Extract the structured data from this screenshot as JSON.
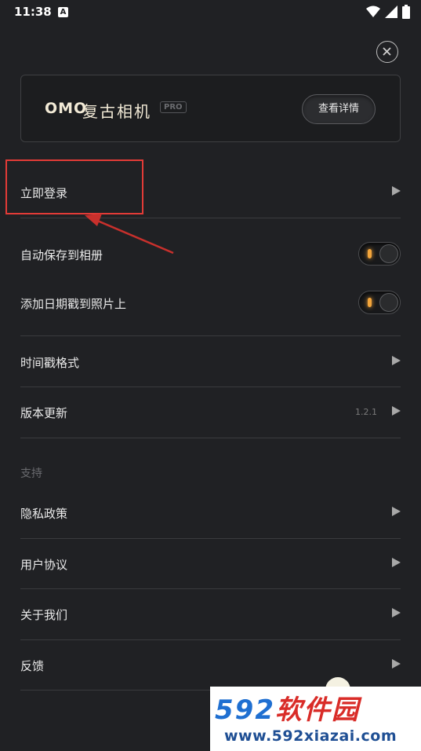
{
  "status_bar": {
    "time": "11:38",
    "notification_badge": "A",
    "icons": [
      "wifi-icon",
      "signal-icon",
      "battery-icon"
    ]
  },
  "promo": {
    "logo": "OMO",
    "name": "复古相机",
    "badge": "PRO",
    "button_label": "查看详情"
  },
  "rows": {
    "login": {
      "label": "立即登录"
    },
    "auto_save": {
      "label": "自动保存到相册",
      "enabled": true
    },
    "date_stamp": {
      "label": "添加日期戳到照片上",
      "enabled": true
    },
    "timestamp_format": {
      "label": "时间戳格式"
    },
    "version_update": {
      "label": "版本更新",
      "version": "1.2.1"
    }
  },
  "support": {
    "title": "支持",
    "items": [
      {
        "label": "隐私政策"
      },
      {
        "label": "用户协议"
      },
      {
        "label": "关于我们"
      },
      {
        "label": "反馈"
      }
    ]
  },
  "watermark": {
    "brand_number": "592",
    "brand_text": "软件园",
    "url": "www.592xiazai.com"
  },
  "colors": {
    "background": "#202124",
    "toggle_led": "#f3a53b",
    "highlight": "#e23b37"
  }
}
